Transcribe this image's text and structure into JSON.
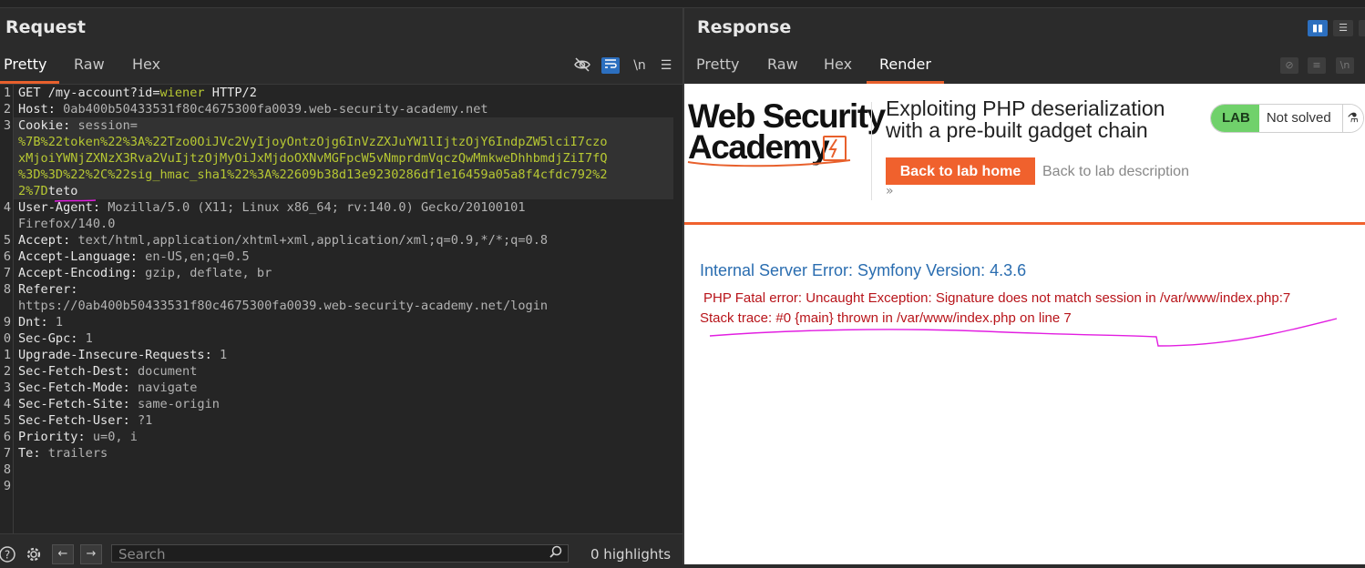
{
  "request": {
    "title": "Request",
    "tabs": [
      "Pretty",
      "Raw",
      "Hex"
    ],
    "active_tab": "Pretty",
    "tools": [
      "eye-off-icon",
      "wrap-icon",
      "newline-toggle",
      "menu-icon"
    ],
    "newline_label": "\\n",
    "lines": [
      {
        "n": "1",
        "parts": [
          [
            "k",
            "GET /my-account?id="
          ],
          [
            "g",
            "wiener"
          ],
          [
            "k",
            " HTTP/2"
          ]
        ]
      },
      {
        "n": "2",
        "parts": [
          [
            "k",
            "Host: "
          ],
          [
            "v",
            "0ab400b50433531f80c4675300fa0039.web-security-academy.net"
          ]
        ]
      },
      {
        "n": "3",
        "parts": [
          [
            "k",
            "Cookie: "
          ],
          [
            "v",
            "session="
          ]
        ]
      },
      {
        "n": "",
        "parts": [
          [
            "g",
            "%7B%22token%22%3A%22Tzo0OiJVc2VyIjoyOntzOjg6InVzZXJuYW1lIjtzOjY6IndpZW5lciI7czo"
          ]
        ]
      },
      {
        "n": "",
        "parts": [
          [
            "g",
            "xMjoiYWNjZXNzX3Rva2VuIjtzOjMyOiJxMjdoOXNvMGFpcW5vNmprdmVqczQwMmkweDhhbmdjZiI7fQ"
          ]
        ]
      },
      {
        "n": "",
        "parts": [
          [
            "g",
            "%3D%3D%22%2C%22sig_hmac_sha1%22%3A%22609b38d13e9230286df1e16459a05a8f4cfdc792%2"
          ]
        ]
      },
      {
        "n": "",
        "parts": [
          [
            "g",
            "2%7D"
          ],
          [
            "k",
            "teto"
          ]
        ]
      },
      {
        "n": "4",
        "parts": [
          [
            "k",
            "User-Agent: "
          ],
          [
            "v",
            "Mozilla/5.0 (X11; Linux x86_64; rv:140.0) Gecko/20100101"
          ]
        ]
      },
      {
        "n": "",
        "parts": [
          [
            "v",
            "Firefox/140.0"
          ]
        ]
      },
      {
        "n": "5",
        "parts": [
          [
            "k",
            "Accept: "
          ],
          [
            "v",
            "text/html,application/xhtml+xml,application/xml;q=0.9,*/*;q=0.8"
          ]
        ]
      },
      {
        "n": "6",
        "parts": [
          [
            "k",
            "Accept-Language: "
          ],
          [
            "v",
            "en-US,en;q=0.5"
          ]
        ]
      },
      {
        "n": "7",
        "parts": [
          [
            "k",
            "Accept-Encoding: "
          ],
          [
            "v",
            "gzip, deflate, br"
          ]
        ]
      },
      {
        "n": "8",
        "parts": [
          [
            "k",
            "Referer: "
          ]
        ]
      },
      {
        "n": "",
        "parts": [
          [
            "v",
            "https://0ab400b50433531f80c4675300fa0039.web-security-academy.net/login"
          ]
        ]
      },
      {
        "n": "9",
        "parts": [
          [
            "k",
            "Dnt: "
          ],
          [
            "v",
            "1"
          ]
        ]
      },
      {
        "n": "0",
        "parts": [
          [
            "k",
            "Sec-Gpc: "
          ],
          [
            "v",
            "1"
          ]
        ]
      },
      {
        "n": "1",
        "parts": [
          [
            "k",
            "Upgrade-Insecure-Requests: "
          ],
          [
            "v",
            "1"
          ]
        ]
      },
      {
        "n": "2",
        "parts": [
          [
            "k",
            "Sec-Fetch-Dest: "
          ],
          [
            "v",
            "document"
          ]
        ]
      },
      {
        "n": "3",
        "parts": [
          [
            "k",
            "Sec-Fetch-Mode: "
          ],
          [
            "v",
            "navigate"
          ]
        ]
      },
      {
        "n": "4",
        "parts": [
          [
            "k",
            "Sec-Fetch-Site: "
          ],
          [
            "v",
            "same-origin"
          ]
        ]
      },
      {
        "n": "5",
        "parts": [
          [
            "k",
            "Sec-Fetch-User: "
          ],
          [
            "v",
            "?1"
          ]
        ]
      },
      {
        "n": "6",
        "parts": [
          [
            "k",
            "Priority: "
          ],
          [
            "v",
            "u=0, i"
          ]
        ]
      },
      {
        "n": "7",
        "parts": [
          [
            "k",
            "Te: "
          ],
          [
            "v",
            "trailers"
          ]
        ]
      },
      {
        "n": "8",
        "parts": []
      },
      {
        "n": "9",
        "parts": []
      }
    ],
    "search": {
      "placeholder": "Search"
    },
    "highlights": "0 highlights"
  },
  "response": {
    "title": "Response",
    "tabs": [
      "Pretty",
      "Raw",
      "Hex",
      "Render"
    ],
    "active_tab": "Render",
    "newline_label": "\\n",
    "render": {
      "logo_line1": "Web Security",
      "logo_line2": "Academy",
      "lab_title": "Exploiting PHP deserialization with a pre-built gadget chain",
      "lab_badge": "LAB",
      "lab_status": "Not solved",
      "back_home": "Back to lab home",
      "back_description": "Back to lab description",
      "chevrons": "»",
      "error_title": "Internal Server Error: Symfony Version: 4.3.6",
      "error_line1": "PHP Fatal error: Uncaught Exception: Signature does not match session in /var/www/index.php:7",
      "error_line2": "Stack trace: #0 {main} thrown in /var/www/index.php on line 7"
    }
  },
  "colors": {
    "accent": "#e8602c",
    "tool_active": "#2c6fbf",
    "cookie_value": "#b7c832",
    "lab_green": "#70d16b",
    "error_red": "#b8141a",
    "error_blue": "#2a6db0",
    "annotation": "#e21ee1"
  }
}
